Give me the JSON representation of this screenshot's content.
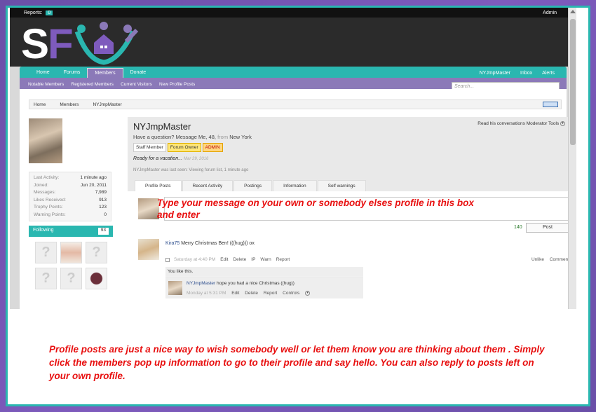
{
  "topbar": {
    "reports_label": "Reports:",
    "reports_count": "0",
    "user": "Admin"
  },
  "nav": {
    "tabs": [
      "Home",
      "Forums",
      "Members",
      "Donate"
    ],
    "right": [
      "NYJmpMaster",
      "Inbox",
      "Alerts"
    ]
  },
  "subnav": {
    "links": [
      "Notable Members",
      "Registered Members",
      "Current Visitors",
      "New Profile Posts"
    ],
    "search_placeholder": "Search..."
  },
  "breadcrumb": [
    "Home",
    "Members",
    "NYJmpMaster"
  ],
  "stats": [
    {
      "k": "Last Activity:",
      "v": "1 minute ago"
    },
    {
      "k": "Joined:",
      "v": "Jun 20, 2011"
    },
    {
      "k": "Messages:",
      "v": "7,989"
    },
    {
      "k": "Likes Received:",
      "v": "913"
    },
    {
      "k": "Trophy Points:",
      "v": "123"
    },
    {
      "k": "Warning Points:",
      "v": "0"
    }
  ],
  "following": {
    "label": "Following",
    "count": "93"
  },
  "profile": {
    "name": "NYJmpMaster",
    "subtitle_pre": "Have a question? Message Me, 48,",
    "subtitle_from": "from",
    "subtitle_loc": "New York",
    "badges": [
      "Staff Member",
      "Forum Owner",
      "ADMIN"
    ],
    "status": "Ready for a vacation...",
    "status_date": "Mar 29, 2016",
    "last_seen": "NYJmpMaster was last seen: Viewing forum list, 1 minute ago",
    "links": [
      "Read his conversations",
      "Moderator Tools"
    ],
    "tabs": [
      "Profile Posts",
      "Recent Activity",
      "Postings",
      "Information",
      "Self warnings"
    ]
  },
  "composer": {
    "counter": "140",
    "post_label": "Post"
  },
  "post": {
    "author": "Kira75",
    "text": "Merry Christmas Ben! (((hug))) ox",
    "time": "Saturday at 4:40 PM",
    "actions": [
      "Edit",
      "Delete",
      "IP",
      "Warn",
      "Report"
    ],
    "actions_right": [
      "Unlike",
      "Comment"
    ],
    "likes": "You like this.",
    "reply": {
      "author": "NYJmpMaster",
      "text": "hope you had a nice Christmas ((hug))",
      "time": "Monday at 5:31 PM",
      "actions": [
        "Edit",
        "Delete",
        "Report",
        "Controls"
      ]
    }
  },
  "overlay_note": "Type your message on your own or somebody elses profile in this box and enter",
  "caption": "Profile posts are just a nice way to wish somebody well or let them know you are thinking about them . Simply click the members pop up information to go to their profile and say hello. You can also reply to posts left on your own profile.",
  "colors": {
    "teal": "#2ab7b0",
    "purple": "#8b79b8",
    "note_red": "#e81010"
  }
}
